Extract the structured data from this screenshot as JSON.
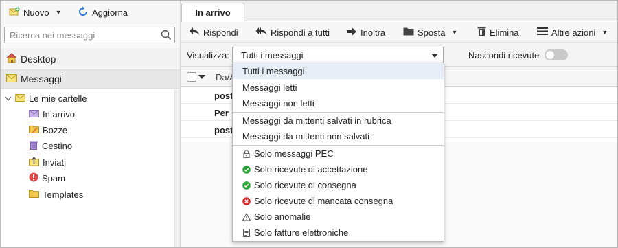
{
  "toolbar": {
    "new_label": "Nuovo",
    "refresh_label": "Aggiorna"
  },
  "search": {
    "placeholder": "Ricerca nei messaggi"
  },
  "nav": {
    "desktop_label": "Desktop",
    "messages_label": "Messaggi"
  },
  "folders": {
    "root_label": "Le mie cartelle",
    "items": [
      {
        "label": "In arrivo",
        "icon": "inbox-icon"
      },
      {
        "label": "Bozze",
        "icon": "drafts-folder-icon"
      },
      {
        "label": "Cestino",
        "icon": "trash-icon"
      },
      {
        "label": "Inviati",
        "icon": "sent-icon"
      },
      {
        "label": "Spam",
        "icon": "spam-icon"
      },
      {
        "label": "Templates",
        "icon": "folder-icon"
      }
    ]
  },
  "tab": {
    "active_label": "In arrivo"
  },
  "actions": {
    "reply": "Rispondi",
    "reply_all": "Rispondi a tutti",
    "forward": "Inoltra",
    "move": "Sposta",
    "delete": "Elimina",
    "more": "Altre azioni"
  },
  "filter": {
    "label": "Visualizza:",
    "selected": "Tutti i messaggi",
    "hide_receipts_label": "Nascondi ricevute",
    "hide_receipts_on": false
  },
  "list": {
    "col_from": "Da/A",
    "rows": [
      "post",
      "Per",
      "post"
    ]
  },
  "dropdown": {
    "options": [
      "Tutti i messaggi",
      "Messaggi letti",
      "Messaggi non letti",
      "Messaggi da mittenti salvati in rubrica",
      "Messaggi da mittenti non salvati",
      "Solo messaggi PEC",
      "Solo ricevute di accettazione",
      "Solo ricevute di consegna",
      "Solo ricevute di mancata consegna",
      "Solo anomalie",
      "Solo fatture elettroniche"
    ],
    "selected_index": 0
  },
  "colors": {
    "accent_blue": "#2b7bd6",
    "ok_green": "#2aa23a",
    "error_red": "#d42a2a",
    "folder_yellow": "#f2c94c",
    "envelope_purple": "#b89ad9"
  }
}
